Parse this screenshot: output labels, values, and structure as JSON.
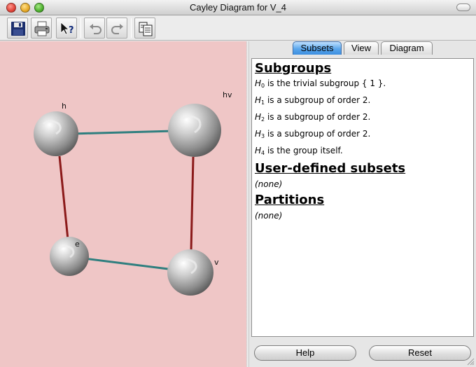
{
  "window": {
    "title": "Cayley Diagram for V_4"
  },
  "toolbar": {
    "buttons": [
      {
        "name": "save-button",
        "icon": "floppy-disk-icon"
      },
      {
        "name": "print-button",
        "icon": "printer-icon"
      },
      {
        "name": "help-cursor-button",
        "icon": "help-cursor-icon"
      },
      {
        "name": "undo-button",
        "icon": "undo-arrow-icon"
      },
      {
        "name": "redo-button",
        "icon": "redo-arrow-icon"
      },
      {
        "name": "copy-button",
        "icon": "copy-pages-icon"
      }
    ]
  },
  "diagram": {
    "background": "#efc6c6",
    "edge_colors": {
      "red": "#8b1a1a",
      "teal": "#2f7f7f"
    },
    "nodes": [
      {
        "id": "h",
        "label": "h"
      },
      {
        "id": "hv",
        "label": "hv"
      },
      {
        "id": "e",
        "label": "e"
      },
      {
        "id": "v",
        "label": "v"
      }
    ]
  },
  "tabs": [
    {
      "label": "Subsets",
      "active": true
    },
    {
      "label": "View",
      "active": false
    },
    {
      "label": "Diagram",
      "active": false
    }
  ],
  "subsets": {
    "subgroups_heading": "Subgroups",
    "subgroups": [
      {
        "name": "H",
        "sub": "0",
        "text": " is the trivial subgroup { 1 }."
      },
      {
        "name": "H",
        "sub": "1",
        "text": " is a subgroup of order 2."
      },
      {
        "name": "H",
        "sub": "2",
        "text": " is a subgroup of order 2."
      },
      {
        "name": "H",
        "sub": "3",
        "text": " is a subgroup of order 2."
      },
      {
        "name": "H",
        "sub": "4",
        "text": " is the group itself."
      }
    ],
    "user_defined_heading": "User-defined subsets",
    "user_defined_value": "(none)",
    "partitions_heading": "Partitions",
    "partitions_value": "(none)"
  },
  "buttons": {
    "help": "Help",
    "reset": "Reset"
  },
  "colors": {
    "tab_active": "#4a98e6"
  }
}
